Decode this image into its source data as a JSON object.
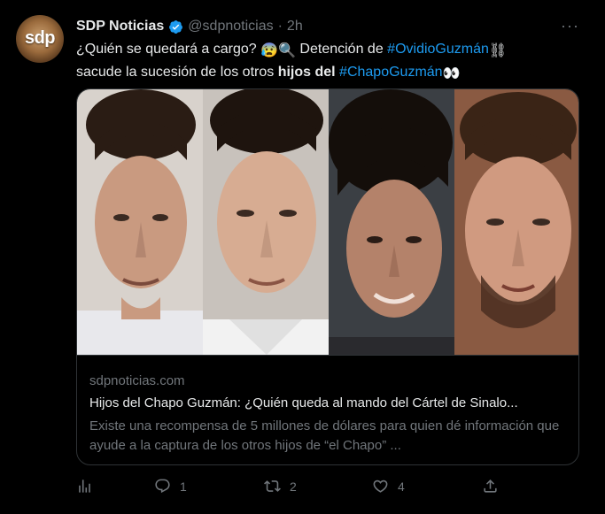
{
  "account": {
    "avatar_text": "sdp",
    "name": "SDP Noticias",
    "handle": "@sdpnoticias",
    "separator": "·",
    "time": "2h"
  },
  "more_label": "···",
  "tweet": {
    "part1": "¿Quién se quedará a cargo? ",
    "emoji1": "😰🔍",
    "part2": " Detención de ",
    "hashtag1": "#OvidioGuzmán",
    "emoji2": " ⛓",
    "part3": "sacude la sucesión de los otros ",
    "bold": "hijos del",
    "part4": " ",
    "hashtag2": "#ChapoGuzmán",
    "emoji3": " 👀"
  },
  "card": {
    "domain": "sdpnoticias.com",
    "title": "Hijos del Chapo Guzmán: ¿Quién queda al mando del Cártel de Sinalo...",
    "description": "Existe una recompensa de 5 millones de dólares para quien dé información que ayude a la captura de los otros hijos de “el Chapo” ..."
  },
  "actions": {
    "views_icon": "analytics-icon",
    "replies": "1",
    "retweets": "2",
    "likes": "4",
    "share_icon": "share-icon"
  },
  "colors": {
    "background": "#000000",
    "text": "#e7e9ea",
    "secondary": "#71767b",
    "accent": "#1d9bf0",
    "border": "#2f3336"
  }
}
